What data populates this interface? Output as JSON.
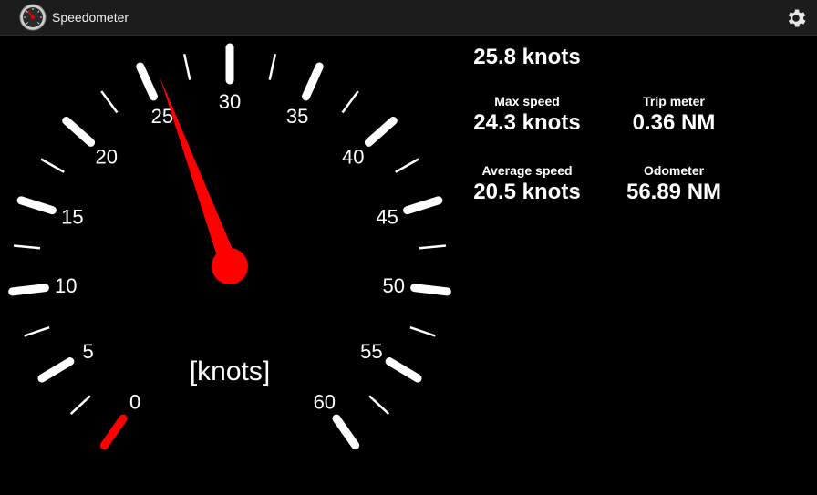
{
  "app": {
    "title": "Speedometer",
    "icon": "speedometer-icon",
    "settings_icon": "gear-icon"
  },
  "gauge": {
    "unit_label": "[knots]",
    "min": 0,
    "max": 60,
    "major_step": 5,
    "needle_value": 25.8,
    "start_angle_deg": 215,
    "end_angle_deg": 505,
    "needle_color": "#ff0000",
    "tick_color": "#ffffff",
    "labels": [
      "0",
      "5",
      "10",
      "15",
      "20",
      "25",
      "30",
      "35",
      "40",
      "45",
      "50",
      "55",
      "60"
    ]
  },
  "stats": {
    "current": {
      "value": "25.8 knots"
    },
    "max_speed": {
      "label": "Max speed",
      "value": "24.3 knots"
    },
    "trip_meter": {
      "label": "Trip meter",
      "value": "0.36 NM"
    },
    "average_speed": {
      "label": "Average speed",
      "value": "20.5 knots"
    },
    "odometer": {
      "label": "Odometer",
      "value": "56.89 NM"
    }
  }
}
